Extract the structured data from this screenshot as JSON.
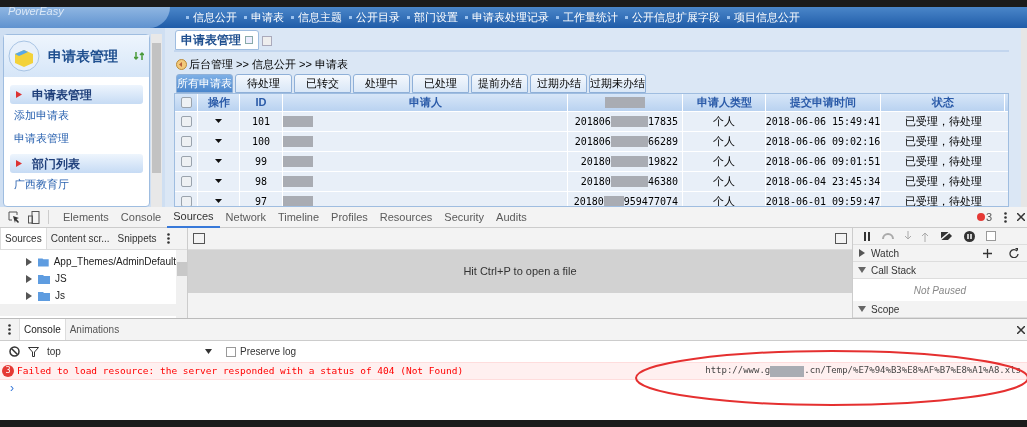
{
  "header": {
    "logo": "PowerEasy",
    "nav": [
      "信息公开",
      "申请表",
      "信息主题",
      "公开目录",
      "部门设置",
      "申请表处理记录",
      "工作量统计",
      "公开信息扩展字段",
      "项目信息公开"
    ]
  },
  "sidebar": {
    "title": "申请表管理",
    "sections": [
      {
        "title": "申请表管理",
        "items": [
          "添加申请表",
          "申请表管理"
        ]
      },
      {
        "title": "部门列表",
        "items": [
          "广西教育厅"
        ]
      }
    ]
  },
  "page_tabs": [
    {
      "label": "申请表管理",
      "selected": true
    }
  ],
  "breadcrumb": "后台管理 >> 信息公开 >> 申请表",
  "status_tabs": [
    {
      "label": "所有申请表",
      "selected": true
    },
    {
      "label": "待处理",
      "selected": false
    },
    {
      "label": "已转交",
      "selected": false
    },
    {
      "label": "处理中",
      "selected": false
    },
    {
      "label": "已处理",
      "selected": false
    },
    {
      "label": "提前办结",
      "selected": false
    },
    {
      "label": "过期办结",
      "selected": false
    },
    {
      "label": "过期未办结",
      "selected": false
    }
  ],
  "table": {
    "select_all_checked": false,
    "columns": [
      {
        "kind": "checkbox"
      },
      {
        "kind": "text",
        "label": "操作"
      },
      {
        "kind": "text",
        "label": "ID"
      },
      {
        "kind": "text",
        "label": "申请人"
      },
      {
        "kind": "masked"
      },
      {
        "kind": "text",
        "label": "申请人类型"
      },
      {
        "kind": "text",
        "label": "提交申请时间"
      },
      {
        "kind": "text",
        "label": "状态"
      }
    ],
    "rows": [
      {
        "checked": false,
        "id": "101",
        "number_start": "201806",
        "number_end": "17835",
        "type": "个人",
        "time": "2018-06-06 15:49:41",
        "status": "已受理，待处理"
      },
      {
        "checked": false,
        "id": "100",
        "number_start": "201806",
        "number_end": "66289",
        "type": "个人",
        "time": "2018-06-06 09:02:16",
        "status": "已受理，待处理"
      },
      {
        "checked": false,
        "id": "99",
        "number_start": "20180",
        "number_end": "19822",
        "type": "个人",
        "time": "2018-06-06 09:01:51",
        "status": "已受理，待处理"
      },
      {
        "checked": false,
        "id": "98",
        "number_start": "20180",
        "number_end": "46380",
        "type": "个人",
        "time": "2018-06-04 23:45:34",
        "status": "已受理，待处理"
      },
      {
        "checked": false,
        "id": "97",
        "number_start": "20180",
        "number_end": "959477074",
        "type": "个人",
        "time": "2018-06-01 09:59:47",
        "status": "已受理，待处理"
      }
    ]
  },
  "devtools": {
    "tabs": [
      {
        "label": "Elements",
        "selected": false
      },
      {
        "label": "Console",
        "selected": false
      },
      {
        "label": "Sources",
        "selected": true
      },
      {
        "label": "Network",
        "selected": false
      },
      {
        "label": "Timeline",
        "selected": false
      },
      {
        "label": "Profiles",
        "selected": false
      },
      {
        "label": "Resources",
        "selected": false
      },
      {
        "label": "Security",
        "selected": false
      },
      {
        "label": "Audits",
        "selected": false
      }
    ],
    "error_count": "3",
    "navigator_tabs": [
      {
        "label": "Sources",
        "selected": true
      },
      {
        "label": "Content scr...",
        "selected": false
      },
      {
        "label": "Snippets",
        "selected": false
      }
    ],
    "tree": [
      {
        "label": "App_Themes/AdminDefault",
        "expanded": false
      },
      {
        "label": "JS",
        "expanded": false
      },
      {
        "label": "Js",
        "expanded": false
      }
    ],
    "editor_hint": "Hit Ctrl+P to open a file",
    "debugger": {
      "panes": [
        {
          "label": "Watch",
          "expanded": false
        },
        {
          "label": "Call Stack",
          "expanded": true
        },
        {
          "label": "Scope",
          "expanded": true
        }
      ],
      "not_paused": "Not Paused",
      "checkbox_checked": false
    },
    "drawer_tabs": [
      {
        "label": "Console",
        "selected": true
      },
      {
        "label": "Animations",
        "selected": false
      }
    ],
    "context": "top",
    "preserve_log": {
      "label": "Preserve log",
      "checked": false
    },
    "messages": [
      {
        "count": "3",
        "text": "Failed to load resource: the server responded with a status of 404 (Not Found)",
        "url_start": "http://www.g",
        "url_end": ".cn/Temp/%E7%94%B3%E8%AF%B7%E8%A1%A8.xls"
      }
    ],
    "prompt": "›"
  }
}
